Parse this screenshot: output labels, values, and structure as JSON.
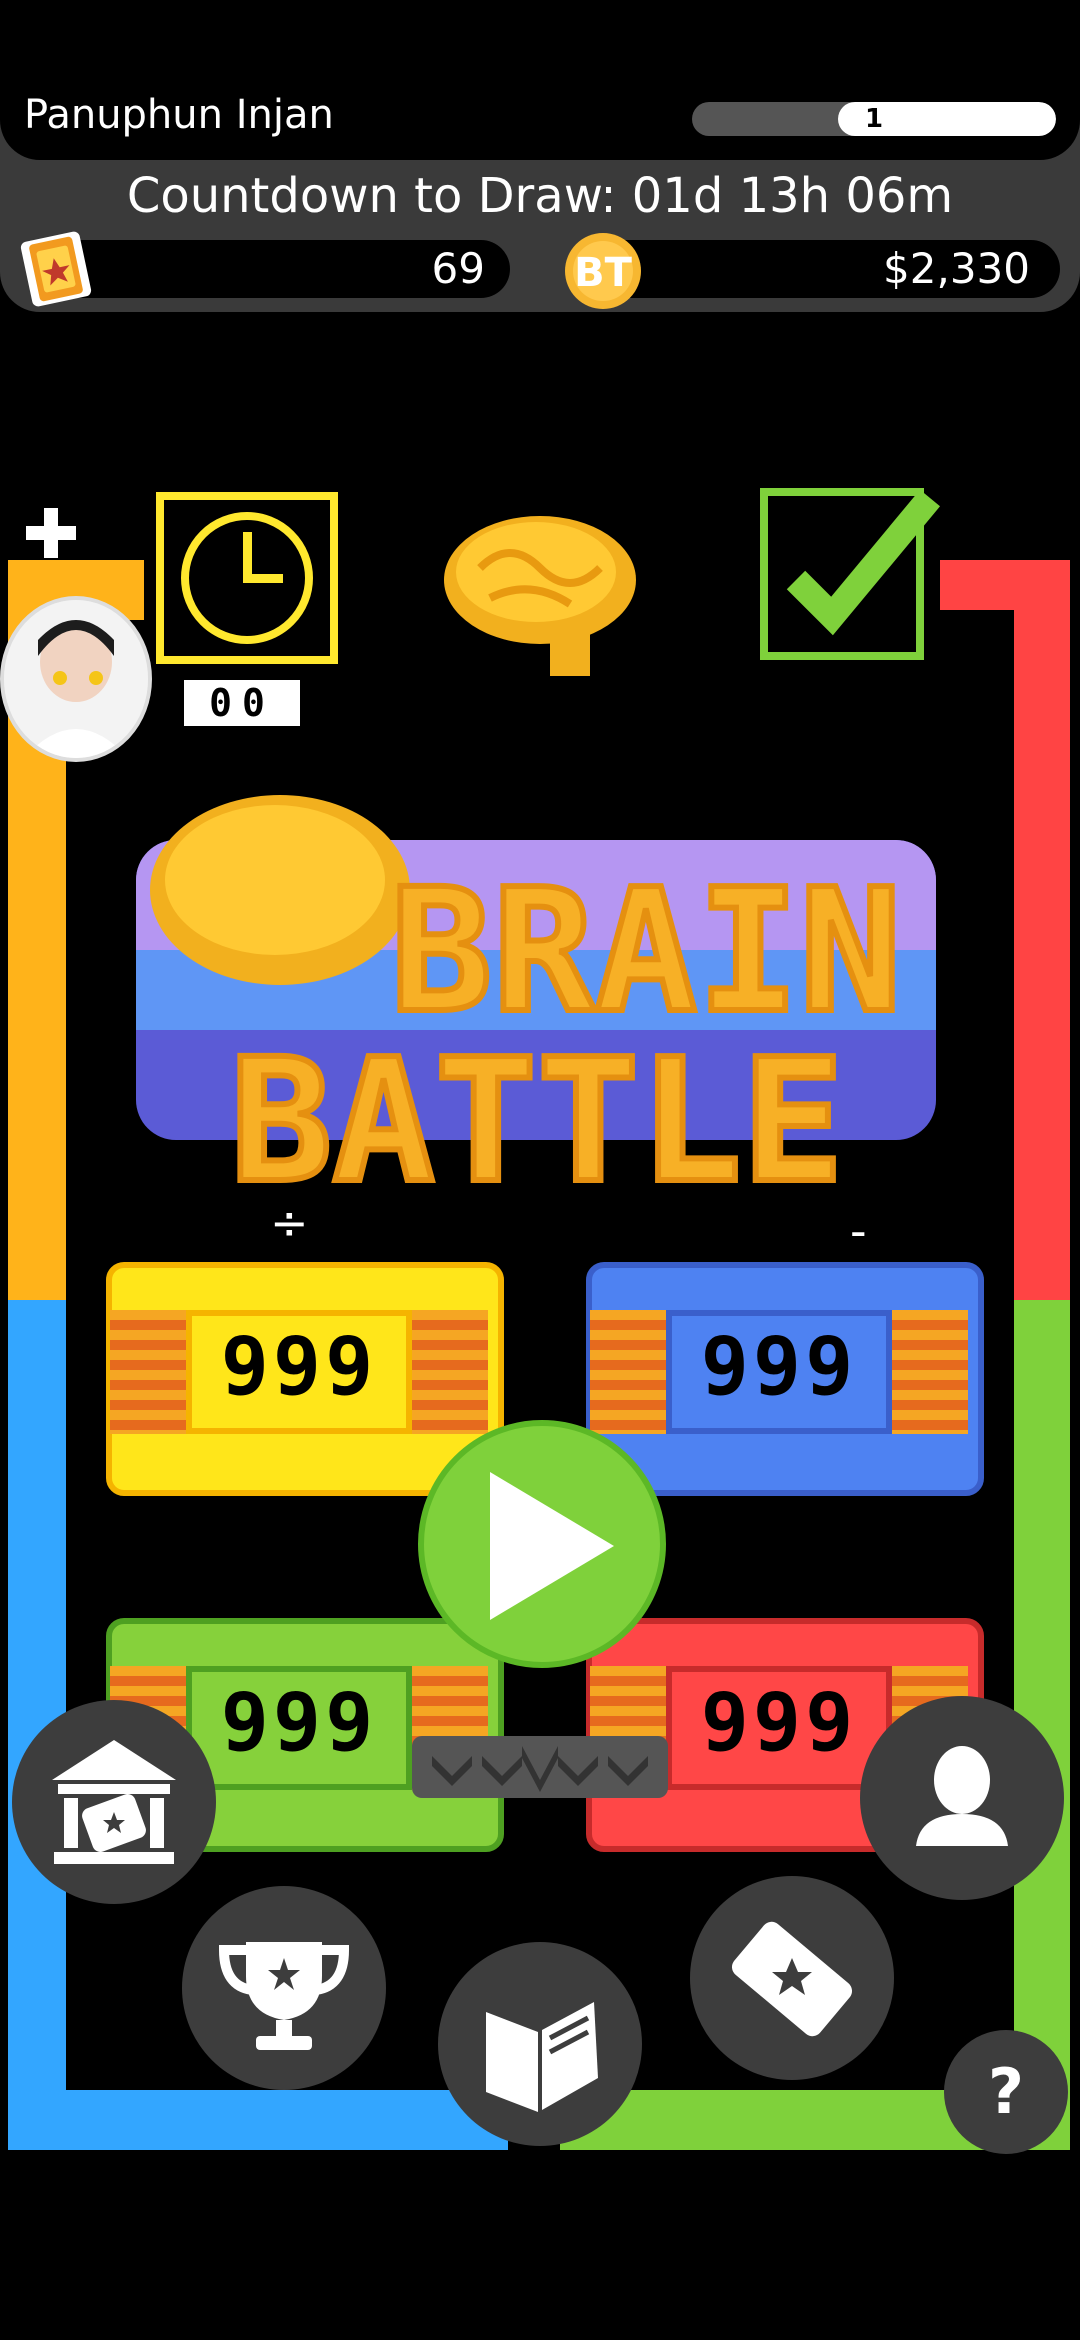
{
  "header": {
    "player_name": "Panuphun Injan",
    "level": "1",
    "level_progress": 0.6,
    "countdown": "Countdown to Draw: 01d 13h 06m",
    "tickets": "69",
    "coins": "$2,330"
  },
  "timer": {
    "value": "00"
  },
  "logo": {
    "line1": "BRAIN",
    "line2": "BATTLE"
  },
  "ops": {
    "divide": "÷",
    "minus": "-"
  },
  "scores": {
    "yellow": "999",
    "blue": "999",
    "green": "999",
    "red": "999"
  },
  "icons": {
    "add": "plus-icon",
    "timer": "clock-icon",
    "brain": "brain-icon",
    "check": "checkmark-icon",
    "play": "play-icon",
    "bank": "museum-ticket-icon",
    "trophy": "trophy-icon",
    "book": "book-icon",
    "ticket": "ticket-icon",
    "profile": "person-icon",
    "help": "question-icon"
  },
  "help_label": "?",
  "colors": {
    "yellow": "#FFB31A",
    "red": "#FF4444",
    "blue": "#33A6FF",
    "green": "#7FD13B",
    "button_gray": "#3D3D3D"
  }
}
